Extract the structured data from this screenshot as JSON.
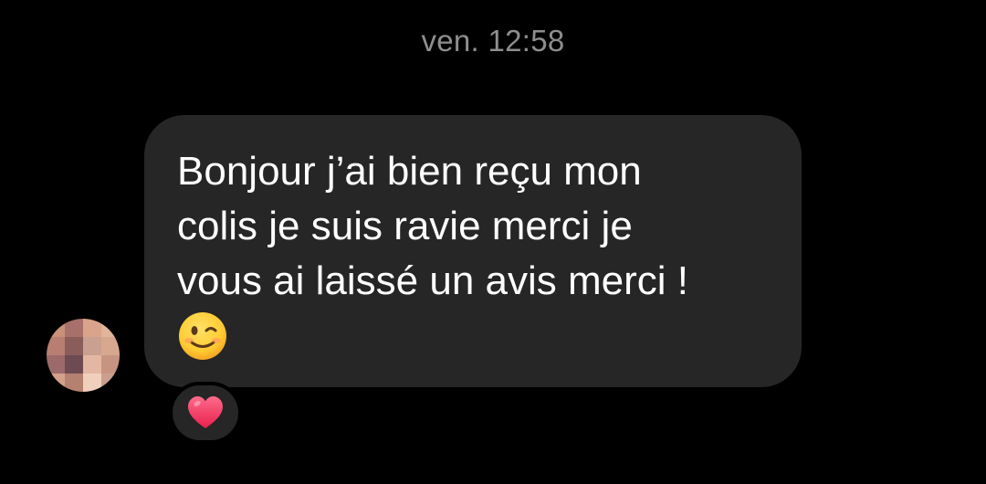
{
  "conversation": {
    "timestamp": "ven. 12:58",
    "message": {
      "text": "Bonjour j’ai bien reçu mon\ncolis je suis ravie merci je\nvous ai laissé un avis merci !",
      "trailing_emoji": "winking-face",
      "bubble_color": "#262626",
      "text_color": "#ffffff"
    },
    "sender": {
      "avatar": "pixelated-avatar"
    },
    "reaction": {
      "emoji": "red-heart",
      "color": "#ff3b6b"
    }
  },
  "theme": {
    "background": "#000000",
    "timestamp_color": "#8e8e8e"
  }
}
